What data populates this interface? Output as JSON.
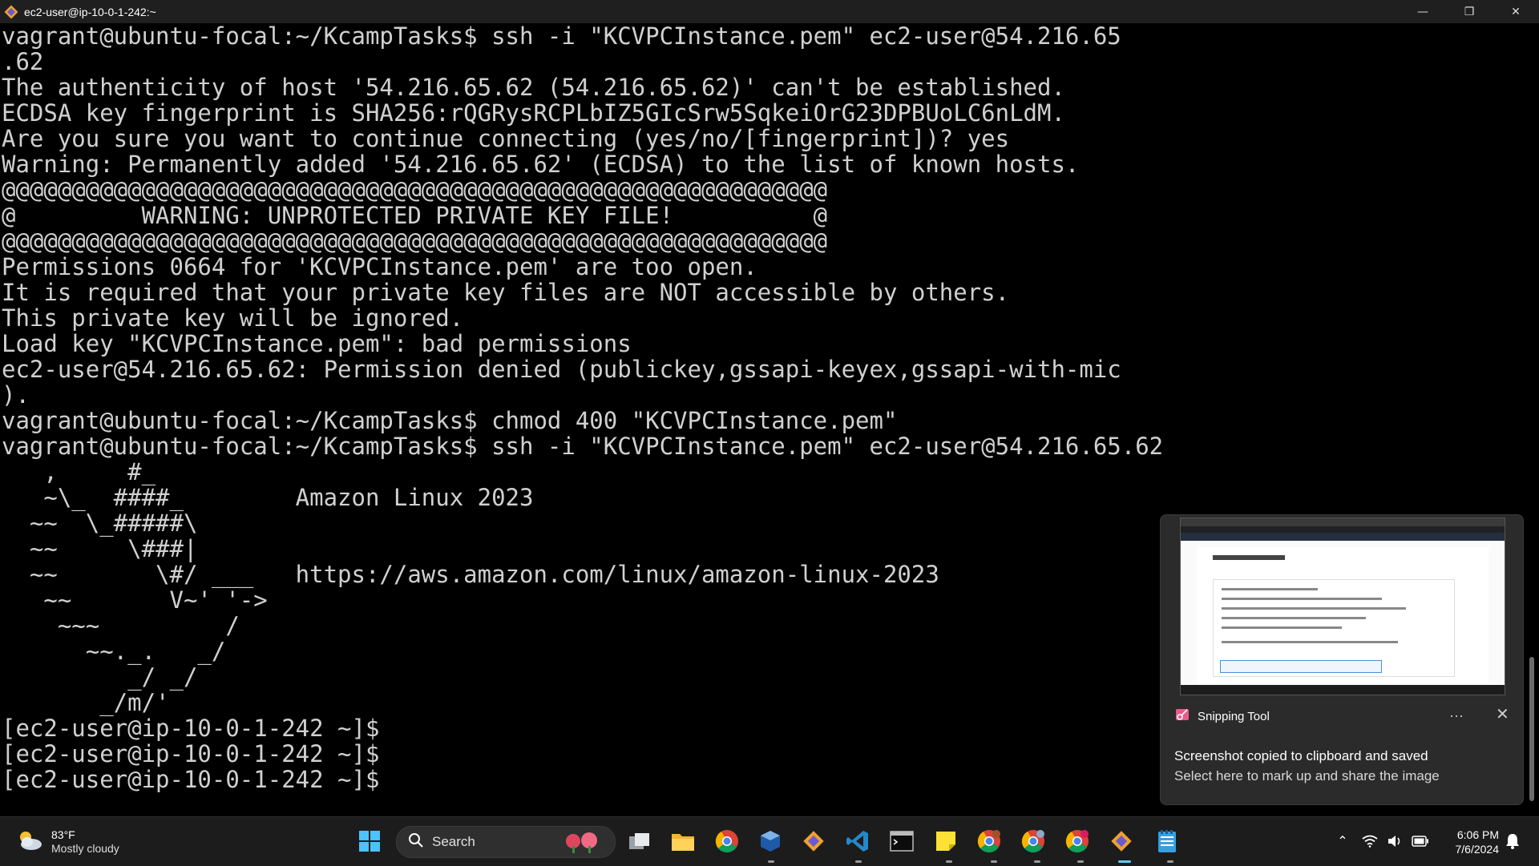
{
  "window": {
    "title": "ec2-user@ip-10-0-1-242:~",
    "min_glyph": "—",
    "max_glyph": "❐",
    "close_glyph": "✕"
  },
  "terminal": {
    "lines": [
      "vagrant@ubuntu-focal:~/KcampTasks$ ssh -i \"KCVPCInstance.pem\" ec2-user@54.216.65",
      ".62",
      "The authenticity of host '54.216.65.62 (54.216.65.62)' can't be established.",
      "ECDSA key fingerprint is SHA256:rQGRysRCPLbIZ5GIcSrw5SqkeiOrG23DPBUoLC6nLdM.",
      "Are you sure you want to continue connecting (yes/no/[fingerprint])? yes",
      "Warning: Permanently added '54.216.65.62' (ECDSA) to the list of known hosts.",
      "@@@@@@@@@@@@@@@@@@@@@@@@@@@@@@@@@@@@@@@@@@@@@@@@@@@@@@@@@@@",
      "@         WARNING: UNPROTECTED PRIVATE KEY FILE!          @",
      "@@@@@@@@@@@@@@@@@@@@@@@@@@@@@@@@@@@@@@@@@@@@@@@@@@@@@@@@@@@",
      "Permissions 0664 for 'KCVPCInstance.pem' are too open.",
      "It is required that your private key files are NOT accessible by others.",
      "This private key will be ignored.",
      "Load key \"KCVPCInstance.pem\": bad permissions",
      "ec2-user@54.216.65.62: Permission denied (publickey,gssapi-keyex,gssapi-with-mic",
      ").",
      "vagrant@ubuntu-focal:~/KcampTasks$ chmod 400 \"KCVPCInstance.pem\"",
      "vagrant@ubuntu-focal:~/KcampTasks$ ssh -i \"KCVPCInstance.pem\" ec2-user@54.216.65.62",
      "   ,     #_",
      "   ~\\_  ####_        Amazon Linux 2023",
      "  ~~  \\_#####\\",
      "  ~~     \\###|",
      "  ~~       \\#/ ___   https://aws.amazon.com/linux/amazon-linux-2023",
      "   ~~       V~' '->",
      "    ~~~         /",
      "      ~~._.   _/",
      "         _/ _/",
      "       _/m/'",
      "[ec2-user@ip-10-0-1-242 ~]$",
      "[ec2-user@ip-10-0-1-242 ~]$",
      "[ec2-user@ip-10-0-1-242 ~]$"
    ]
  },
  "toast": {
    "app_name": "Snipping Tool",
    "more_glyph": "···",
    "close_glyph": "✕",
    "title": "Screenshot copied to clipboard and saved",
    "body": "Select here to mark up and share the image"
  },
  "taskbar": {
    "weather_temp": "83°F",
    "weather_condition": "Mostly cloudy",
    "search_label": "Search",
    "time": "6:06 PM",
    "date": "7/6/2024",
    "chevron_glyph": "⌃",
    "colors": {
      "accent": "#60cdff",
      "background": "#1c1c1c"
    }
  }
}
